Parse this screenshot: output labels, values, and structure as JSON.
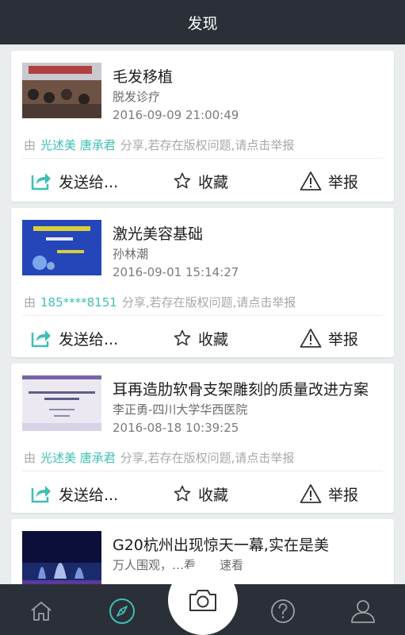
{
  "header": {
    "title": "发现"
  },
  "actions": {
    "send_label": "发送给...",
    "favorite_label": "收藏",
    "report_label": "举报"
  },
  "share": {
    "prefix": "由",
    "suffix": "分享,若存在版权问题,请点击举报"
  },
  "posts": [
    {
      "title": "毛发移植",
      "subtitle": "脱发诊疗",
      "time": "2016-09-09 21:00:49",
      "sharer": "光述美 唐承君"
    },
    {
      "title": "激光美容基础",
      "subtitle": "孙林潮",
      "time": "2016-09-01 15:14:27",
      "sharer": "185****8151"
    },
    {
      "title": "耳再造肋软骨支架雕刻的质量改进方案",
      "subtitle": "李正勇-四川大学华西医院",
      "time": "2016-08-18 10:39:25",
      "sharer": "光述美 唐承君"
    },
    {
      "title": "G20杭州出现惊天一幕,实在是美",
      "subtitle": "万人围观，…看…，速看",
      "time": "",
      "sharer": ""
    }
  ],
  "tabbar": {
    "items": [
      "home-icon",
      "compass-icon",
      "camera-icon",
      "question-icon",
      "user-icon"
    ],
    "active_color": "#3ebfb5",
    "icon_color": "#9aa0a6"
  }
}
